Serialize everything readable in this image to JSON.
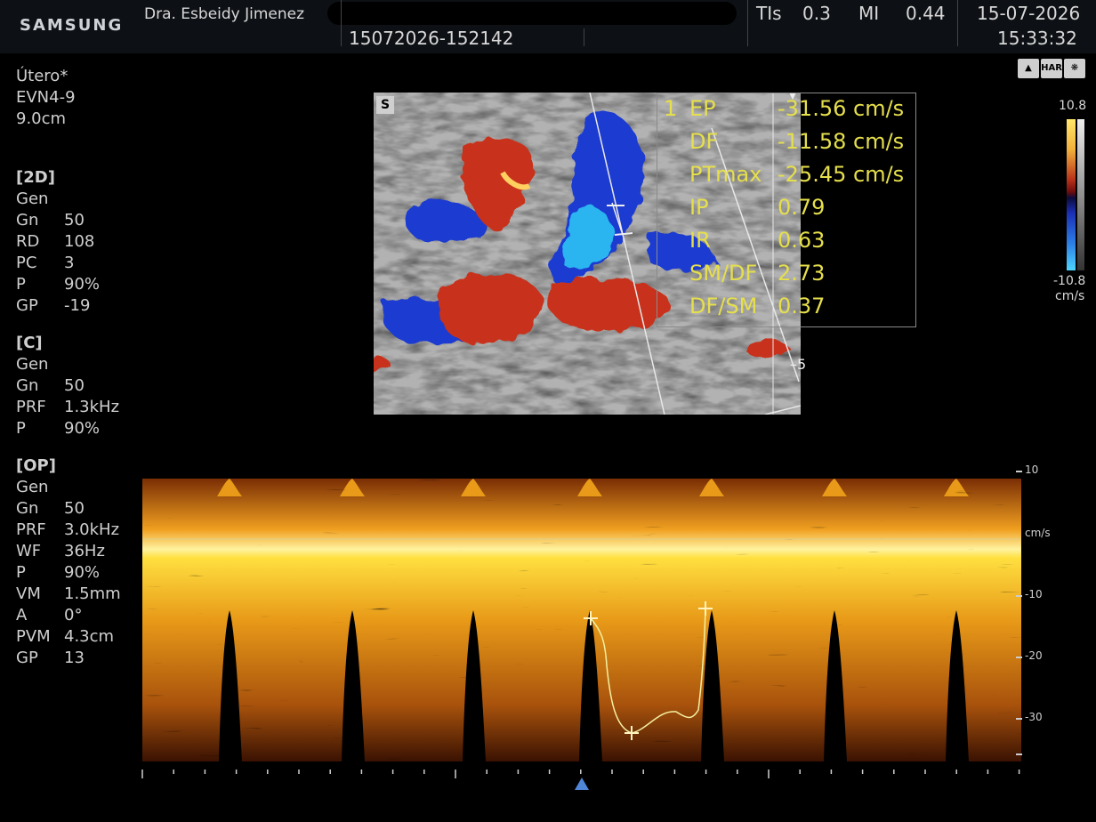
{
  "header": {
    "brand": "SAMSUNG",
    "operator": "Dra. Esbeidy Jimenez",
    "exam_id": "15072026-152142",
    "tis_label": "TIs",
    "tis_value": "0.3",
    "mi_label": "MI",
    "mi_value": "0.44",
    "date": "15-07-2026",
    "time": "15:33:32"
  },
  "probe": {
    "preset": "Útero*",
    "transducer": "EVN4-9",
    "depth": "9.0cm"
  },
  "sections": {
    "b2d": {
      "title": "[2D]",
      "mode": "Gen",
      "rows": [
        {
          "k": "Gn",
          "v": "50"
        },
        {
          "k": "RD",
          "v": "108"
        },
        {
          "k": "PC",
          "v": "3"
        },
        {
          "k": "P",
          "v": "90%"
        },
        {
          "k": "GP",
          "v": "-19"
        }
      ]
    },
    "color": {
      "title": "[C]",
      "mode": "Gen",
      "rows": [
        {
          "k": "Gn",
          "v": "50"
        },
        {
          "k": "PRF",
          "v": "1.3kHz"
        },
        {
          "k": "P",
          "v": "90%"
        }
      ]
    },
    "pw": {
      "title": "[OP]",
      "mode": "Gen",
      "rows": [
        {
          "k": "Gn",
          "v": "50"
        },
        {
          "k": "PRF",
          "v": "3.0kHz"
        },
        {
          "k": "WF",
          "v": "36Hz"
        },
        {
          "k": "P",
          "v": "90%"
        },
        {
          "k": "VM",
          "v": "1.5mm"
        },
        {
          "k": "A",
          "v": "0°"
        },
        {
          "k": "PVM",
          "v": "4.3cm"
        },
        {
          "k": "GP",
          "v": "13"
        }
      ]
    }
  },
  "mode_icons": [
    "bell-icon",
    "HAR",
    "film-reel-icon"
  ],
  "mode_icon_har": "HAR",
  "color_scale": {
    "top": "10.8",
    "bottom": "-10.8",
    "unit": "cm/s"
  },
  "bmode_marker": "S",
  "depth_mark": "5",
  "measurements": {
    "index": "1",
    "rows": [
      {
        "label": "EP",
        "value": "-31.56 cm/s"
      },
      {
        "label": "DF",
        "value": "-11.58 cm/s"
      },
      {
        "label": "PTmax",
        "value": "-25.45 cm/s"
      },
      {
        "label": "IP",
        "value": "0.79"
      },
      {
        "label": "IR",
        "value": "0.63"
      },
      {
        "label": "SM/DF",
        "value": "2.73"
      },
      {
        "label": "DF/SM",
        "value": "0.37"
      }
    ]
  },
  "velocity_axis": {
    "unit": "cm/s",
    "ticks": [
      "10",
      "-10",
      "-20",
      "-30"
    ]
  },
  "trace_label": "1",
  "colors": {
    "measure_text": "#e6df4c",
    "spectrum": "#ffcc22",
    "flow_red": "#c8321a",
    "flow_blue": "#1f3ad0"
  }
}
